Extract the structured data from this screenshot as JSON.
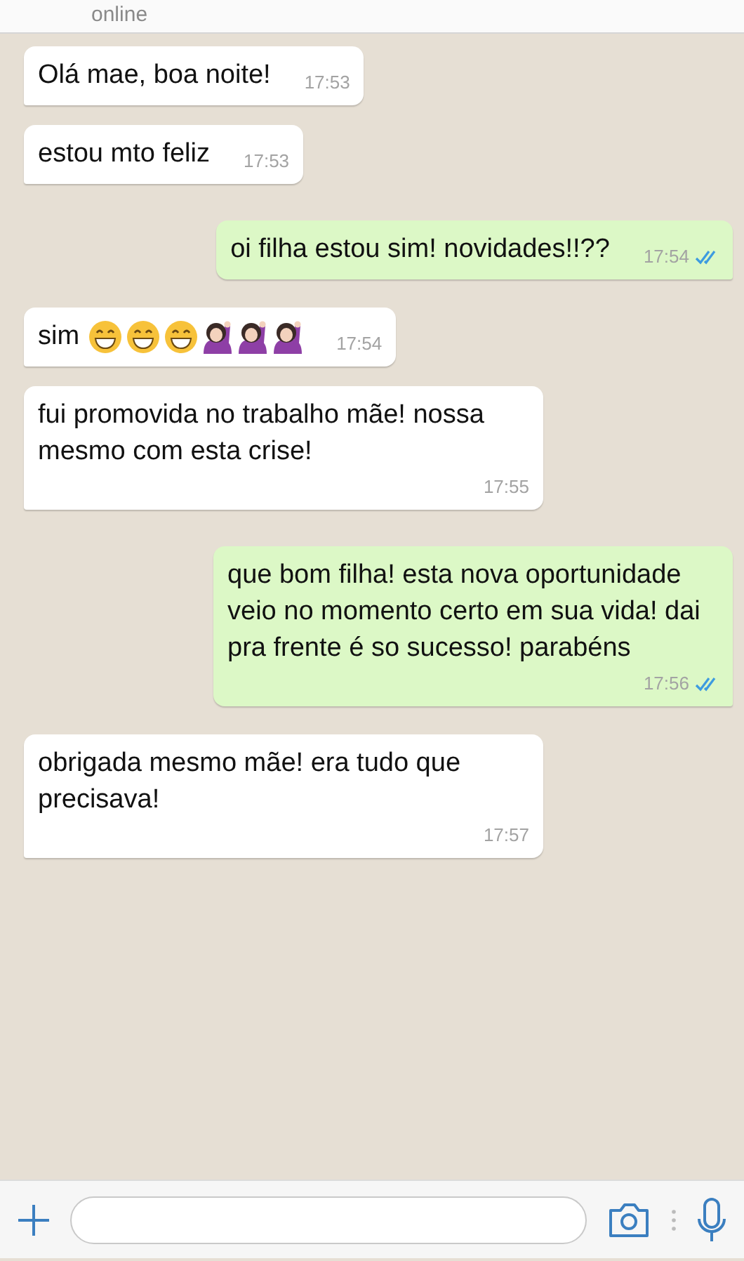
{
  "header": {
    "status": "online"
  },
  "messages": [
    {
      "kind": "incoming",
      "text": "Olá mae, boa noite!",
      "time": "17:53"
    },
    {
      "kind": "incoming",
      "text": "estou mto feliz",
      "time": "17:53"
    },
    {
      "kind": "outgoing",
      "text": "oi filha estou sim! novidades!!??",
      "time": "17:54",
      "read": true
    },
    {
      "kind": "incoming",
      "text": "sim",
      "emojis": [
        {
          "kind": "grin"
        },
        {
          "kind": "grin"
        },
        {
          "kind": "grin"
        },
        {
          "kind": "raising_hand"
        },
        {
          "kind": "raising_hand"
        },
        {
          "kind": "raising_hand"
        }
      ],
      "time": "17:54"
    },
    {
      "kind": "incoming",
      "text": "fui promovida no trabalho mãe! nossa mesmo com esta crise!",
      "time": "17:55"
    },
    {
      "kind": "outgoing",
      "text": "que bom filha! esta nova oportunidade veio no momento certo em sua vida! dai pra frente é so sucesso! parabéns",
      "time": "17:56",
      "read": true
    },
    {
      "kind": "incoming",
      "text": "obrigada mesmo mãe! era tudo que precisava!",
      "time": "17:57"
    }
  ]
}
